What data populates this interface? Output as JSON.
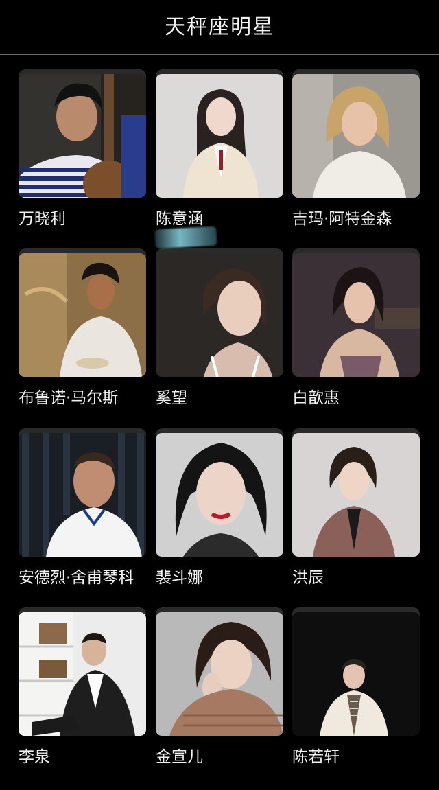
{
  "header": {
    "title": "天秤座明星"
  },
  "cards": [
    {
      "name": "万晓利",
      "photo_icon": "man-with-guitar-portrait",
      "bg": "#3a3836"
    },
    {
      "name": "陈意涵",
      "photo_icon": "woman-portrait",
      "bg": "#d9d7d6"
    },
    {
      "name": "吉玛·阿特金森",
      "photo_icon": "woman-portrait",
      "bg": "#9c9994"
    },
    {
      "name": "布鲁诺·马尔斯",
      "photo_icon": "man-portrait",
      "bg": "#8a6d45"
    },
    {
      "name": "奚望",
      "photo_icon": "woman-portrait",
      "bg": "#2e2a28"
    },
    {
      "name": "白歆惠",
      "photo_icon": "woman-portrait",
      "bg": "#3b3137"
    },
    {
      "name": "安德烈·舍甫琴科",
      "photo_icon": "man-portrait",
      "bg": "#1b2026"
    },
    {
      "name": "裴斗娜",
      "photo_icon": "woman-portrait",
      "bg": "#cfcfcf"
    },
    {
      "name": "洪辰",
      "photo_icon": "woman-portrait",
      "bg": "#d7d3d2"
    },
    {
      "name": "李泉",
      "photo_icon": "man-portrait",
      "bg": "#e8e8e8"
    },
    {
      "name": "金宣儿",
      "photo_icon": "woman-portrait",
      "bg": "#b8b8b8"
    },
    {
      "name": "陈若轩",
      "photo_icon": "man-portrait",
      "bg": "#0f0f0f"
    }
  ]
}
